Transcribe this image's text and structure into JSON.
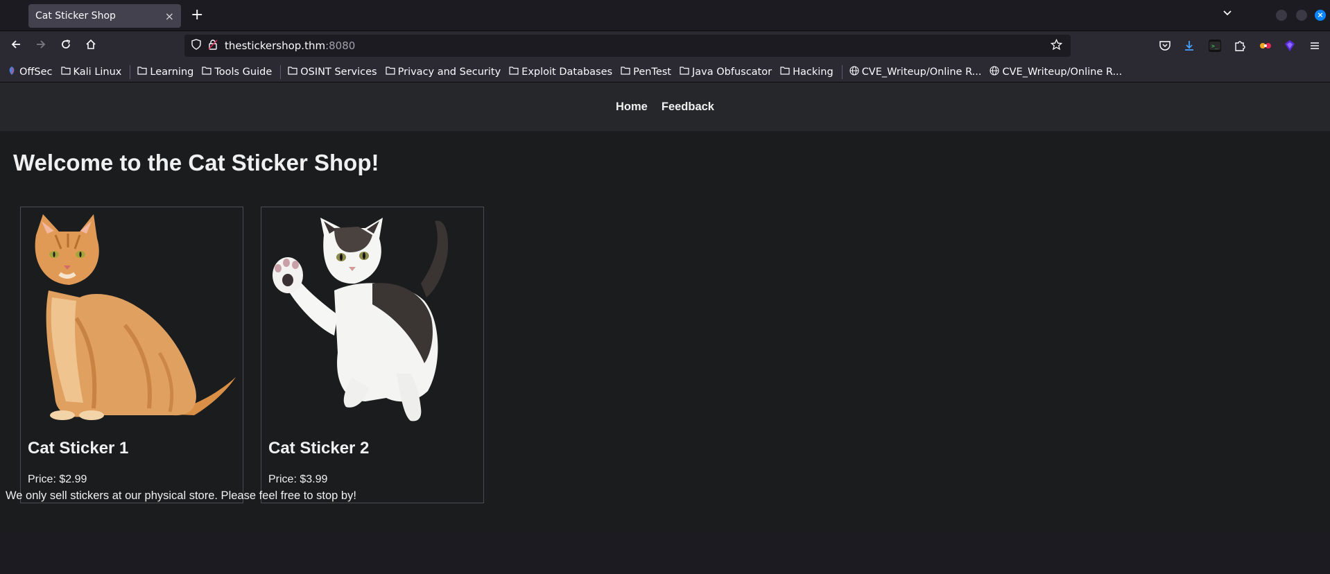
{
  "browser": {
    "tab_title": "Cat Sticker Shop",
    "tab_close": "×",
    "new_tab": "+",
    "url_host": "thestickershop.thm",
    "url_port": ":8080",
    "bookmarks": [
      {
        "label": "OffSec",
        "icon": "offsec-icon"
      },
      {
        "label": "Kali Linux",
        "icon": "folder-icon"
      },
      {
        "label": "Learning",
        "icon": "folder-icon"
      },
      {
        "label": "Tools Guide",
        "icon": "folder-icon"
      },
      {
        "label": "OSINT Services",
        "icon": "folder-icon"
      },
      {
        "label": "Privacy and Security",
        "icon": "folder-icon"
      },
      {
        "label": "Exploit Databases",
        "icon": "folder-icon"
      },
      {
        "label": "PenTest",
        "icon": "folder-icon"
      },
      {
        "label": "Java Obfuscator",
        "icon": "folder-icon"
      },
      {
        "label": "Hacking",
        "icon": "folder-icon"
      },
      {
        "label": "CVE_Writeup/Online R...",
        "icon": "globe-icon"
      },
      {
        "label": "CVE_Writeup/Online R...",
        "icon": "globe-icon"
      }
    ]
  },
  "site": {
    "nav": {
      "home": "Home",
      "feedback": "Feedback"
    },
    "heading": "Welcome to the Cat Sticker Shop!",
    "products": [
      {
        "name": "Cat Sticker 1",
        "price": "Price: $2.99",
        "image": "orange-tabby-cat"
      },
      {
        "name": "Cat Sticker 2",
        "price": "Price: $3.99",
        "image": "white-tabby-kitten-waving"
      }
    ],
    "footer": "We only sell stickers at our physical store. Please feel free to stop by!"
  },
  "colors": {
    "page_bg": "#1b1c1e",
    "nav_bg": "#25272a",
    "text": "#f0f0f0",
    "card_border": "#4a4c50"
  }
}
